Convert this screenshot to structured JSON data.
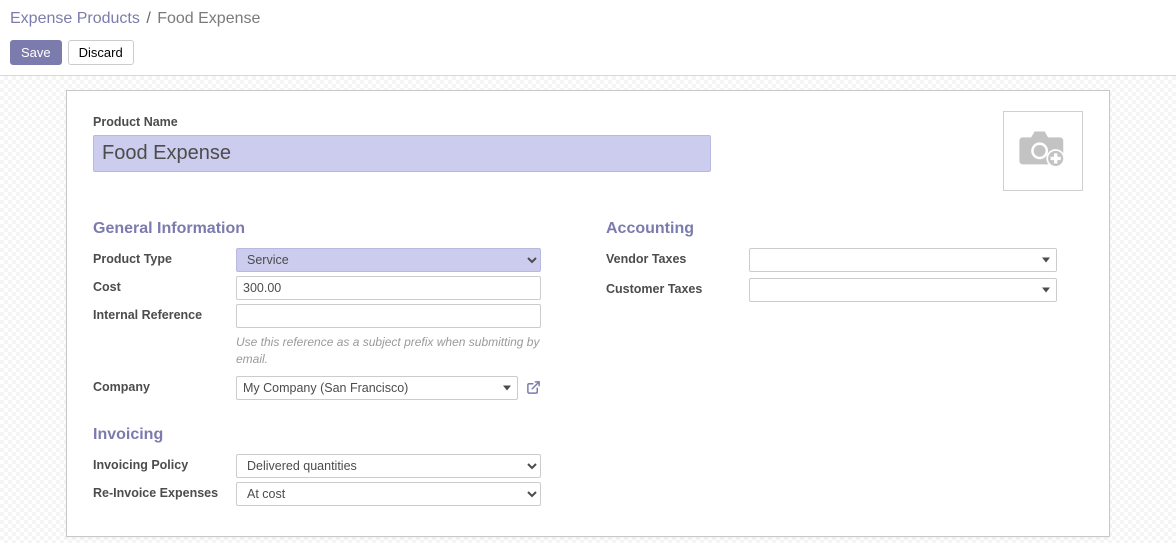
{
  "breadcrumb": {
    "parent": "Expense Products",
    "separator": "/",
    "current": "Food Expense"
  },
  "actions": {
    "save": "Save",
    "discard": "Discard"
  },
  "product_name_label": "Product Name",
  "product_name_value": "Food Expense",
  "general": {
    "title": "General Information",
    "product_type_label": "Product Type",
    "product_type_value": "Service",
    "cost_label": "Cost",
    "cost_value": "300.00",
    "internal_ref_label": "Internal Reference",
    "internal_ref_value": "",
    "internal_ref_help": "Use this reference as a subject prefix when submitting by email.",
    "company_label": "Company",
    "company_value": "My Company (San Francisco)"
  },
  "accounting": {
    "title": "Accounting",
    "vendor_taxes_label": "Vendor Taxes",
    "customer_taxes_label": "Customer Taxes"
  },
  "invoicing": {
    "title": "Invoicing",
    "policy_label": "Invoicing Policy",
    "policy_value": "Delivered quantities",
    "reinvoice_label": "Re-Invoice Expenses",
    "reinvoice_value": "At cost"
  }
}
